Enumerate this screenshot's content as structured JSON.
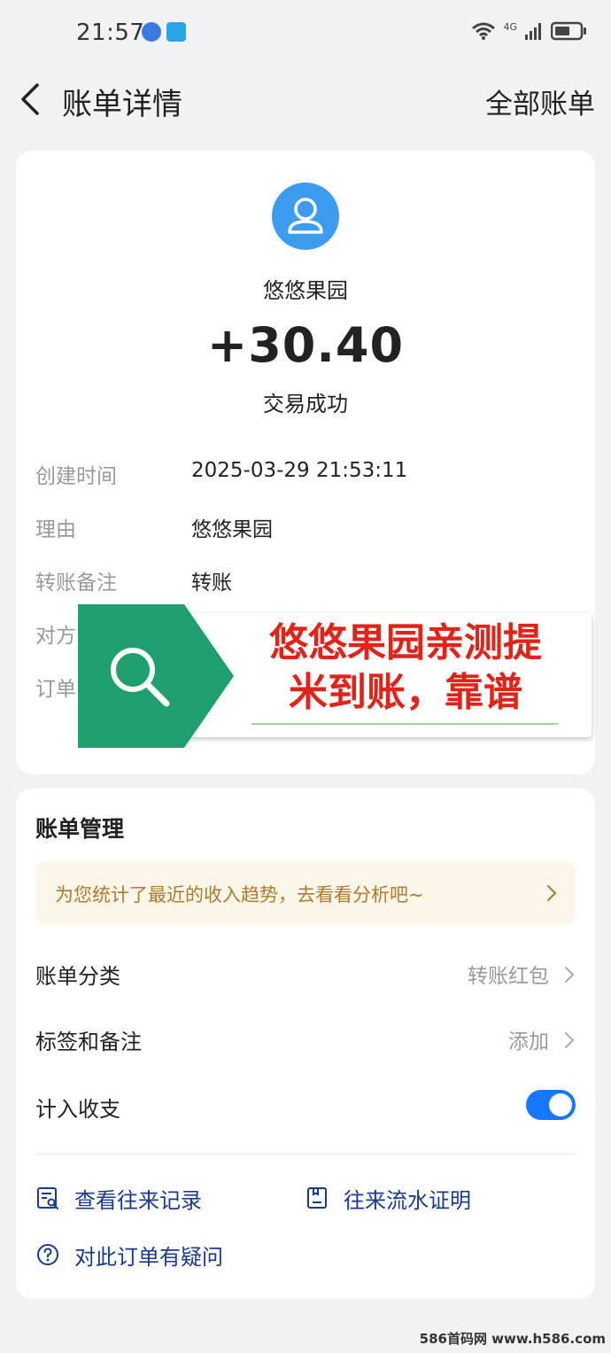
{
  "status_bar": {
    "time": "21:57",
    "network_label": "4G",
    "icons": [
      "location-share-icon",
      "app-notification-icon",
      "wifi-icon",
      "signal-icon",
      "battery-icon"
    ]
  },
  "nav": {
    "back_icon": "chevron-left-icon",
    "title": "账单详情",
    "right_link": "全部账单"
  },
  "transaction": {
    "payee": "悠悠果园",
    "amount": "+30.40",
    "status": "交易成功",
    "details": [
      {
        "key": "创建时间",
        "value": "2025-03-29 21:53:11"
      },
      {
        "key": "理由",
        "value": "悠悠果园"
      },
      {
        "key": "转账备注",
        "value": "转账"
      },
      {
        "key": "对方",
        "value": ""
      },
      {
        "key": "订单",
        "value": ""
      }
    ]
  },
  "overlay": {
    "line1": "悠悠果园亲测提",
    "line2": "米到账，靠谱",
    "icon": "search-icon",
    "colors": {
      "tag": "#1f9e6e",
      "text": "#e2231a"
    }
  },
  "management": {
    "title": "账单管理",
    "banner_text": "为您统计了最近的收入趋势，去看看分析吧~",
    "rows": [
      {
        "label": "账单分类",
        "value": "转账红包"
      },
      {
        "label": "标签和备注",
        "value": "添加"
      },
      {
        "label": "计入收支",
        "toggle_on": true
      }
    ],
    "links": [
      {
        "label": "查看往来记录",
        "icon": "record-search-icon"
      },
      {
        "label": "往来流水证明",
        "icon": "document-icon"
      },
      {
        "label": "对此订单有疑问",
        "icon": "question-circle-icon"
      }
    ]
  },
  "watermark": "586首码网 www.h586.com",
  "colors": {
    "accent": "#1677ff",
    "avatar": "#3d9bf0",
    "link": "#1a3a8a"
  }
}
